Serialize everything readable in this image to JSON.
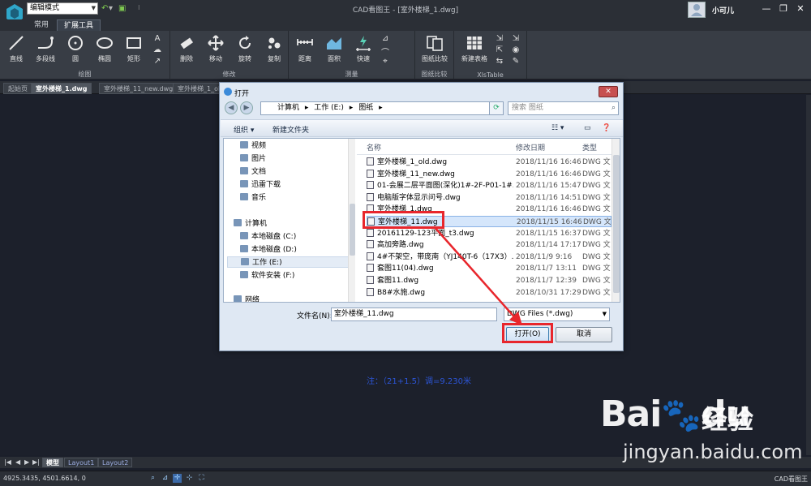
{
  "app": {
    "title": "CAD看图王 - [室外楼梯_1.dwg]",
    "mode": "编辑模式",
    "user": "小可儿",
    "controls": {
      "minimize": "—",
      "restore": "❐",
      "close": "✕"
    }
  },
  "menu_tabs": [
    {
      "label": "常用",
      "active": false
    },
    {
      "label": "扩展工具",
      "active": true
    }
  ],
  "ribbon": {
    "groups": [
      {
        "label": "绘图",
        "buttons": [
          "直线",
          "多段线",
          "圆",
          "椭圆",
          "矩形"
        ]
      },
      {
        "label": "修改",
        "buttons": [
          "删除",
          "移动",
          "旋转",
          "复制"
        ]
      },
      {
        "label": "测量",
        "buttons": [
          "距离",
          "面积",
          "快速"
        ]
      },
      {
        "label": "图纸比较",
        "buttons": [
          "图纸比较"
        ]
      },
      {
        "label": "XlsTable",
        "buttons": [
          "新建表格"
        ]
      }
    ]
  },
  "doc_tabs": [
    {
      "label": "起始页",
      "active": false
    },
    {
      "label": "室外楼梯_1.dwg",
      "active": true
    },
    {
      "label": "室外楼梯_11_new.dwg",
      "active": false
    },
    {
      "label": "室外楼梯_1_ol",
      "active": false
    }
  ],
  "canvas": {
    "annotation": "注：（21+1.5）调=9.230米"
  },
  "layout_tabs": [
    {
      "label": "模型",
      "active": true
    },
    {
      "label": "Layout1",
      "active": false
    },
    {
      "label": "Layout2",
      "active": false
    }
  ],
  "status": {
    "coords": "4925.3435, 4501.6614, 0",
    "app": "CAD看图王"
  },
  "dialog": {
    "title": "打开",
    "path": [
      "计算机",
      "工作 (E:)",
      "图纸"
    ],
    "search_placeholder": "搜索 图纸",
    "toolbar": {
      "organize": "组织 ▾",
      "new_folder": "新建文件夹"
    },
    "nav_items": [
      {
        "label": "视频",
        "selected": false
      },
      {
        "label": "图片",
        "selected": false
      },
      {
        "label": "文档",
        "selected": false
      },
      {
        "label": "迅雷下载",
        "selected": false
      },
      {
        "label": "音乐",
        "selected": false
      },
      {
        "label": "计算机",
        "selected": false
      },
      {
        "label": "本地磁盘 (C:)",
        "selected": false
      },
      {
        "label": "本地磁盘 (D:)",
        "selected": false
      },
      {
        "label": "工作 (E:)",
        "selected": true
      },
      {
        "label": "软件安装 (F:)",
        "selected": false
      },
      {
        "label": "网络",
        "selected": false
      }
    ],
    "columns": {
      "name": "名称",
      "date": "修改日期",
      "type": "类型"
    },
    "files": [
      {
        "name": "室外楼梯_1_old.dwg",
        "date": "2018/11/16 16:46",
        "type": "DWG 文"
      },
      {
        "name": "室外楼梯_11_new.dwg",
        "date": "2018/11/16 16:46",
        "type": "DWG 文"
      },
      {
        "name": "01-会展二层平面图(深化)1#-2F-P01-1#...",
        "date": "2018/11/16 15:47",
        "type": "DWG 文"
      },
      {
        "name": "电脑版字体显示问号.dwg",
        "date": "2018/11/16 14:51",
        "type": "DWG 文"
      },
      {
        "name": "室外楼梯_1.dwg",
        "date": "2018/11/16 16:46",
        "type": "DWG 文"
      },
      {
        "name": "室外楼梯_11.dwg",
        "date": "2018/11/15 16:46",
        "type": "DWG 文"
      },
      {
        "name": "20161129-123平面_t3.dwg",
        "date": "2018/11/15 16:37",
        "type": "DWG 文"
      },
      {
        "name": "高加旁路.dwg",
        "date": "2018/11/14 17:17",
        "type": "DWG 文"
      },
      {
        "name": "4#不架空，带庞南（YJ140T-6（17X3）...",
        "date": "2018/11/9 9:16",
        "type": "DWG 文"
      },
      {
        "name": "套图11(04).dwg",
        "date": "2018/11/7 13:11",
        "type": "DWG 文"
      },
      {
        "name": "套图11.dwg",
        "date": "2018/11/7 12:39",
        "type": "DWG 文"
      },
      {
        "name": "B8#水施.dwg",
        "date": "2018/10/31 17:29",
        "type": "DWG 文"
      }
    ],
    "filename_label": "文件名(N):",
    "filename_value": "室外楼梯_11.dwg",
    "filetype": "DWG Files (*.dwg)",
    "open_button": "打开(O)",
    "cancel_button": "取消"
  },
  "watermark": {
    "brand": "Baidu",
    "product": "经验",
    "url": "jingyan.baidu.com"
  },
  "colors": {
    "accent_red": "#e8262c",
    "canvas": "#1c202b",
    "dialog": "#dfe8f3"
  }
}
